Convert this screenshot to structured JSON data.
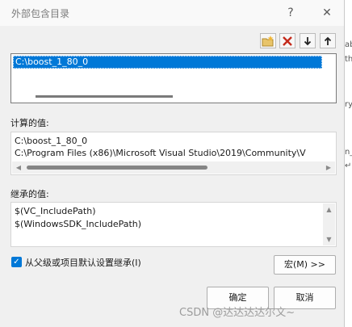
{
  "window": {
    "title": "外部包含目录",
    "help_icon": "?",
    "close_icon": "✕"
  },
  "toolbar": {
    "new_icon": "folder-star-icon",
    "delete_icon": "red-x-icon",
    "down_icon": "arrow-down-icon",
    "up_icon": "arrow-up-icon"
  },
  "list": {
    "selected_value": "C:\\boost_1_80_0"
  },
  "computed": {
    "label": "计算的值:",
    "lines": [
      "C:\\boost_1_80_0",
      "C:\\Program Files (x86)\\Microsoft Visual Studio\\2019\\Community\\V"
    ]
  },
  "inherited": {
    "label": "继承的值:",
    "lines": [
      "$(VC_IncludePath)",
      "$(WindowsSDK_IncludePath)"
    ]
  },
  "inherit_checkbox": {
    "label": "从父级或项目默认设置继承(I)",
    "checked": true
  },
  "buttons": {
    "macros": "宏(M) >>",
    "ok": "确定",
    "cancel": "取消"
  },
  "watermark": "CSDN @达达达达尔文~",
  "background_fragments": [
    "ab",
    "th",
    "ry",
    "n_",
    "↵"
  ],
  "colors": {
    "accent": "#0078d7",
    "delete": "#c42b1c"
  }
}
